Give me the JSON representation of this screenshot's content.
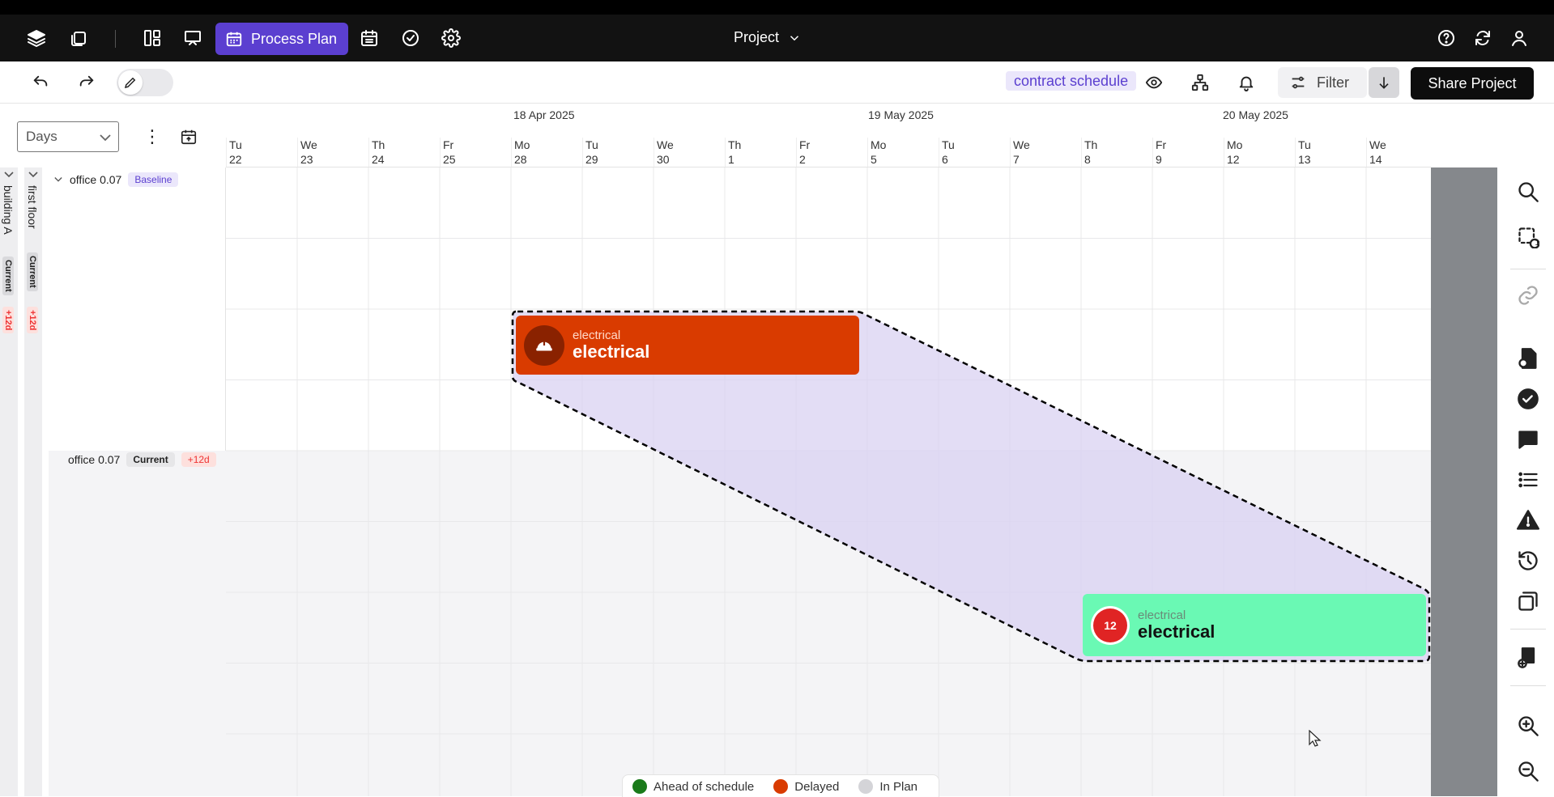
{
  "navbar": {
    "active_tab": "Process Plan",
    "project_menu": "Project"
  },
  "toolbar": {
    "schedule_tag": "contract schedule",
    "filter_label": "Filter",
    "share_label": "Share Project"
  },
  "controls": {
    "zoom_select": "Days"
  },
  "hierarchy": {
    "level1_label": "building A",
    "level1_status": "Current",
    "level1_delay": "+12d",
    "level2_label": "first floor",
    "level2_status": "Current",
    "level2_delay": "+12d"
  },
  "rows": [
    {
      "label": "office 0.07",
      "badge": "Baseline"
    },
    {
      "label": "office 0.07",
      "badge": "Current",
      "delay": "+12d"
    }
  ],
  "timeline": {
    "months": [
      "18 Apr 2025",
      "19 May 2025",
      "20 May 2025"
    ],
    "days": [
      {
        "dow": "Tu",
        "num": "22"
      },
      {
        "dow": "We",
        "num": "23"
      },
      {
        "dow": "Th",
        "num": "24"
      },
      {
        "dow": "Fr",
        "num": "25"
      },
      {
        "dow": "Mo",
        "num": "28"
      },
      {
        "dow": "Tu",
        "num": "29"
      },
      {
        "dow": "We",
        "num": "30"
      },
      {
        "dow": "Th",
        "num": "1"
      },
      {
        "dow": "Fr",
        "num": "2"
      },
      {
        "dow": "Mo",
        "num": "5"
      },
      {
        "dow": "Tu",
        "num": "6"
      },
      {
        "dow": "We",
        "num": "7"
      },
      {
        "dow": "Th",
        "num": "8"
      },
      {
        "dow": "Fr",
        "num": "9"
      },
      {
        "dow": "Mo",
        "num": "12"
      },
      {
        "dow": "Tu",
        "num": "13"
      },
      {
        "dow": "We",
        "num": "14"
      }
    ]
  },
  "tasks": {
    "baseline": {
      "trade": "electrical",
      "name": "electrical",
      "color": "#d93b00"
    },
    "current": {
      "trade": "electrical",
      "name": "electrical",
      "color": "#6af9b4",
      "badge_number": "12",
      "badge_color": "#e02424"
    }
  },
  "legend": [
    {
      "label": "Ahead of schedule",
      "color": "#1a7a1a"
    },
    {
      "label": "Delayed",
      "color": "#d93b00"
    },
    {
      "label": "In Plan",
      "color": "#d4d4d8"
    }
  ],
  "rail": {
    "selection_count": "1"
  },
  "colors": {
    "accent": "#5b3fd0",
    "shift_fill": "#d9d2f2"
  }
}
